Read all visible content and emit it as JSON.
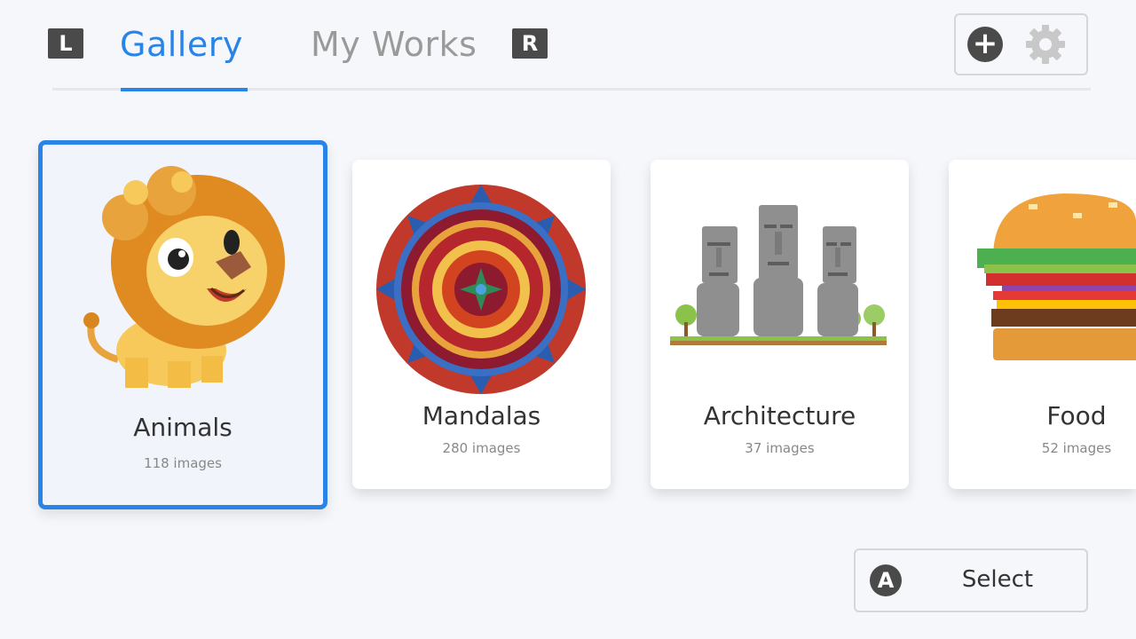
{
  "header": {
    "left_shoulder": "L",
    "right_shoulder": "R",
    "tabs": [
      {
        "label": "Gallery",
        "active": true
      },
      {
        "label": "My Works",
        "active": false
      }
    ],
    "actions": {
      "add_icon": "plus-circle-icon",
      "settings_icon": "gear-icon"
    }
  },
  "categories": [
    {
      "title": "Animals",
      "count": "118 images",
      "selected": true,
      "icon": "lion-illustration"
    },
    {
      "title": "Mandalas",
      "count": "280 images",
      "selected": false,
      "icon": "mandala-illustration"
    },
    {
      "title": "Architecture",
      "count": "37 images",
      "selected": false,
      "icon": "moai-statues-illustration"
    },
    {
      "title": "Food",
      "count": "52 images",
      "selected": false,
      "icon": "burger-illustration"
    }
  ],
  "footer": {
    "button_glyph": "A",
    "button_label": "Select"
  },
  "colors": {
    "accent": "#2a84e8",
    "background": "#f5f7fa",
    "inactive_tab": "#9a9a9a",
    "button_dark": "#4a4a4a"
  }
}
